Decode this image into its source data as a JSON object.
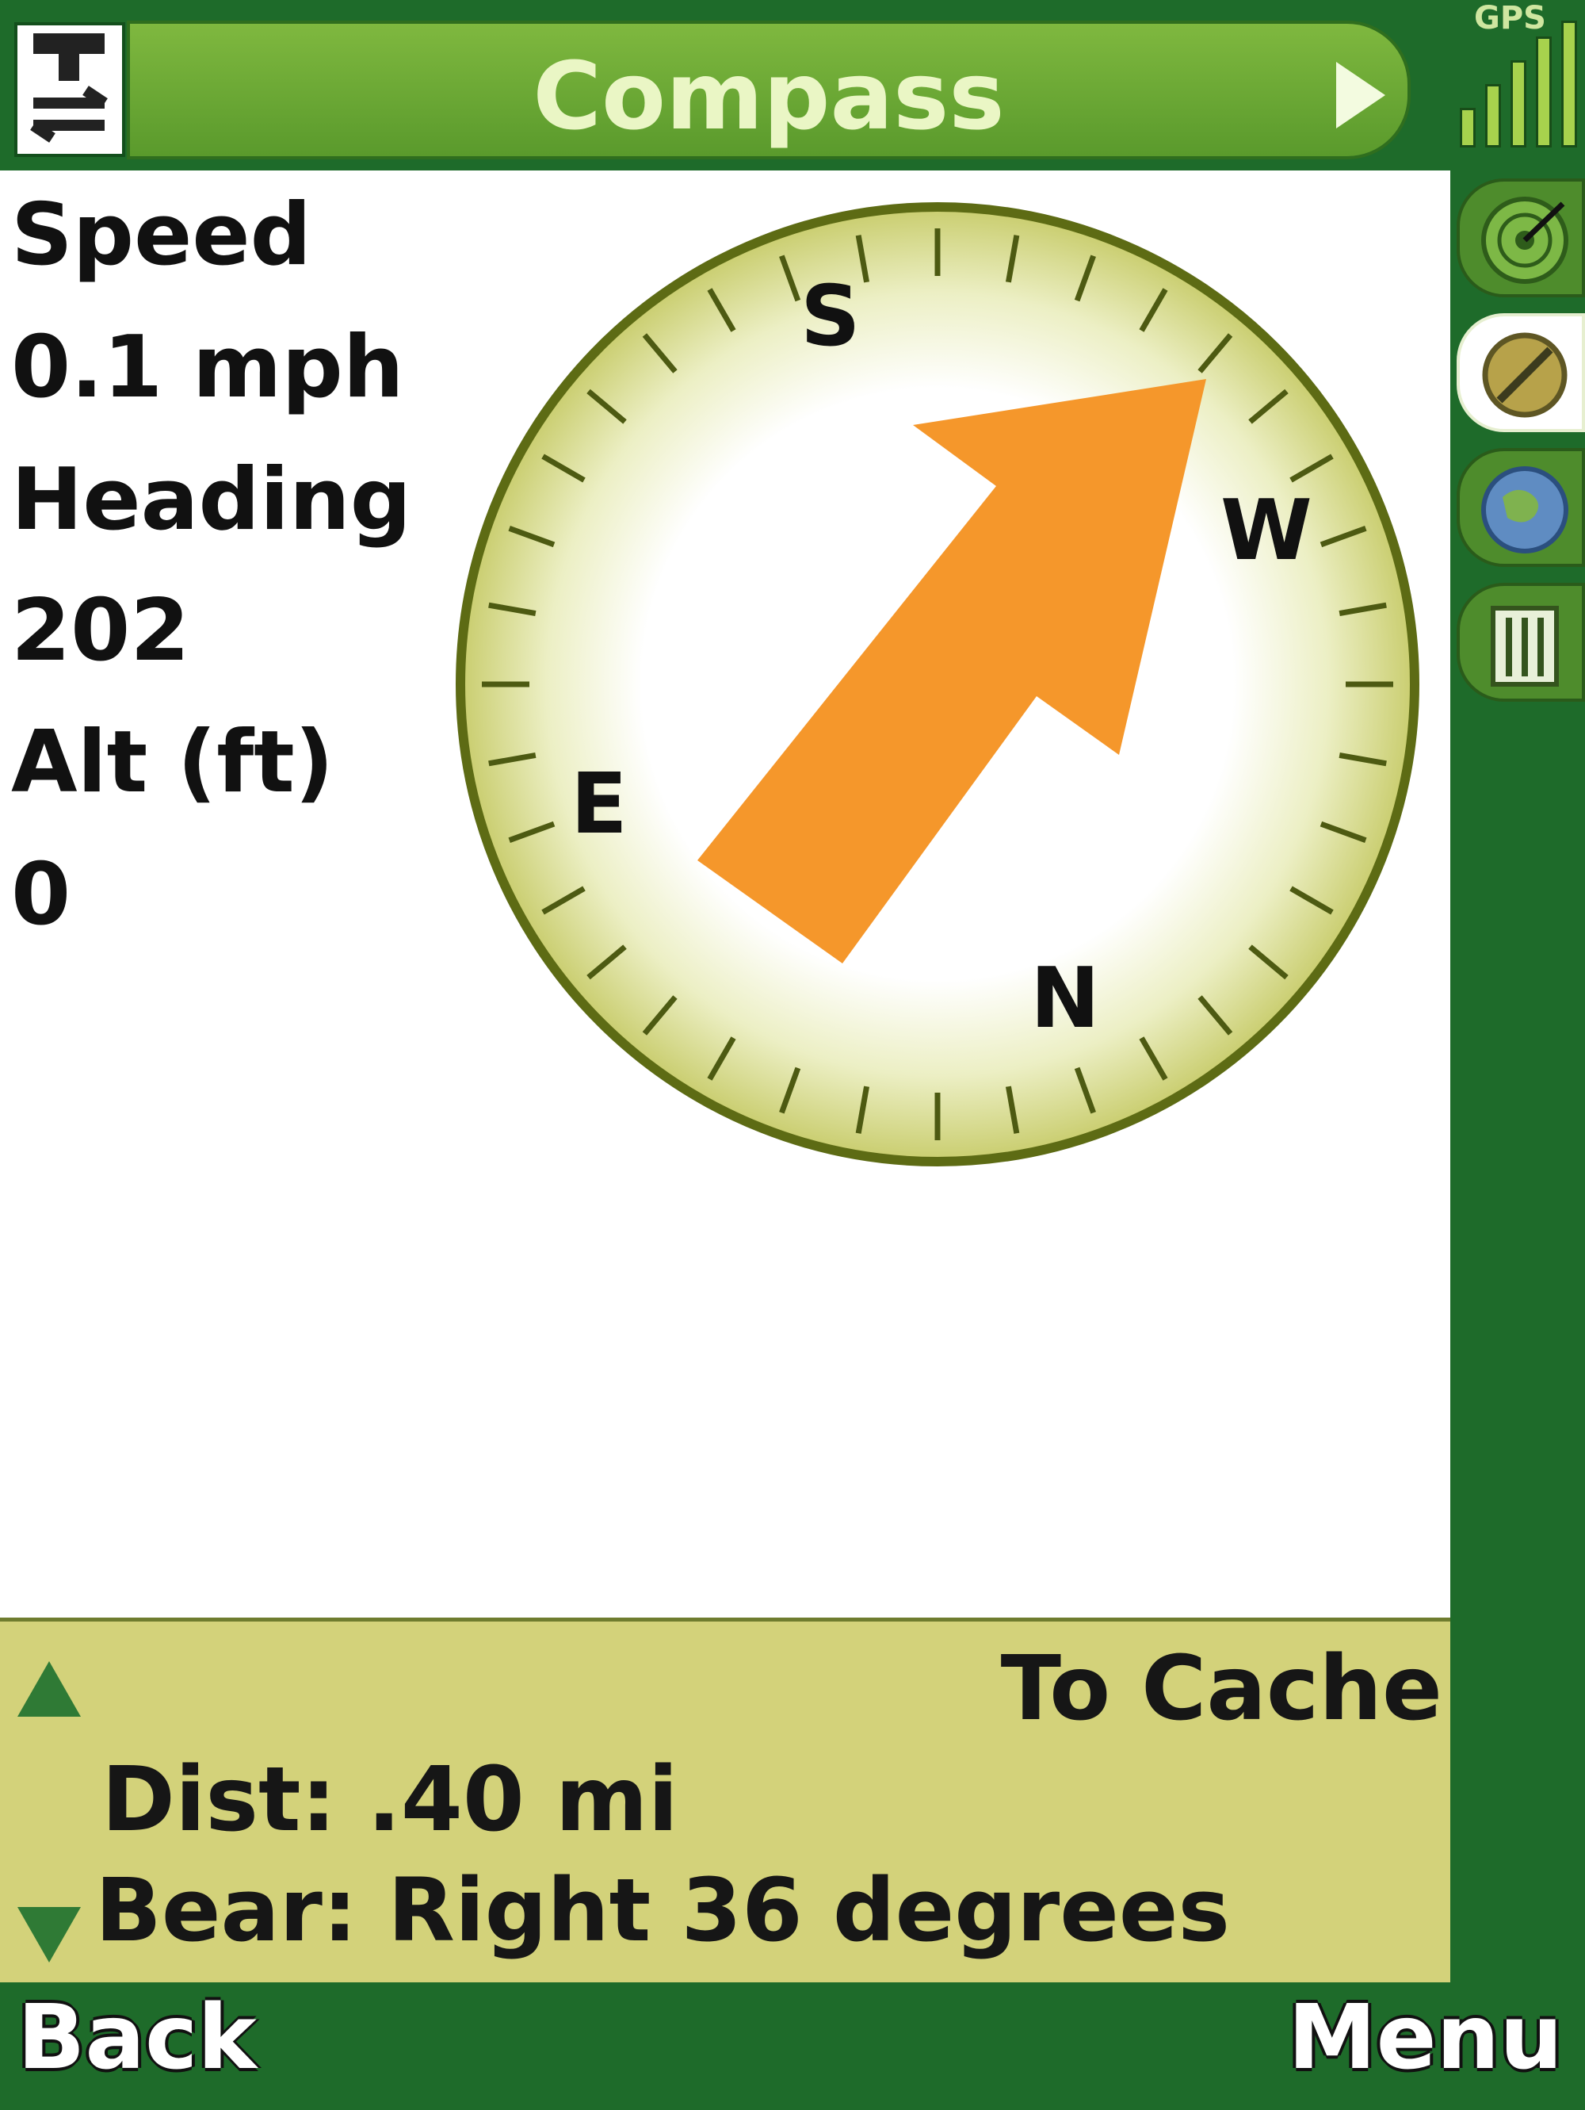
{
  "header": {
    "title": "Compass",
    "gps_label": "GPS",
    "left_icon": "geocache-swap-icon"
  },
  "stats": {
    "speed_label": "Speed",
    "speed_value": "0.1 mph",
    "heading_label": "Heading",
    "heading_value": "202",
    "alt_label": "Alt (ft)",
    "alt_value": "0"
  },
  "compass": {
    "labels": {
      "s": "S",
      "w": "W",
      "e": "E",
      "n": "N"
    },
    "arrow_color": "#f5972b",
    "dial_color": "#cfd07a"
  },
  "side_tabs": [
    {
      "icon": "radar-icon",
      "active": false
    },
    {
      "icon": "compass-icon",
      "active": true
    },
    {
      "icon": "globe-icon",
      "active": false
    },
    {
      "icon": "list-icon",
      "active": false
    }
  ],
  "info": {
    "target": "To Cache",
    "distance": "Dist: .40 mi",
    "bearing": "Bear: Right 36 degrees"
  },
  "softkeys": {
    "left": "Back",
    "right": "Menu"
  },
  "colors": {
    "frame": "#1e6b2a",
    "title_bar": "#6aa835",
    "panel": "#d3d27a"
  }
}
